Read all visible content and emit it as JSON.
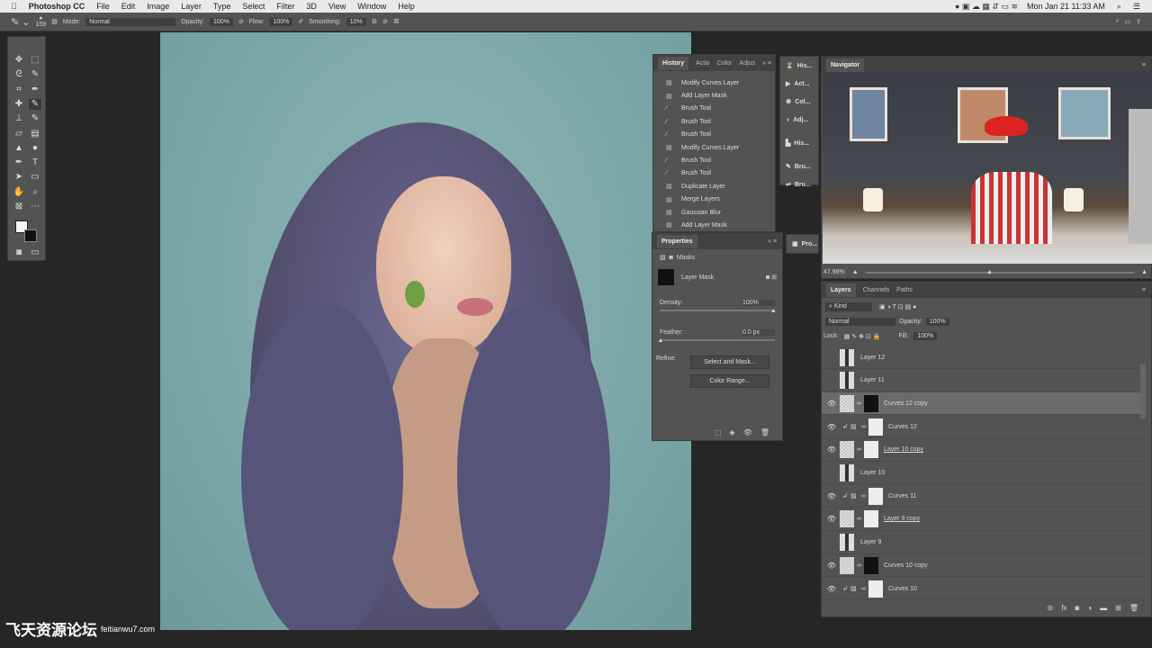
{
  "menubar": {
    "app": "Photoshop CC",
    "items": [
      "File",
      "Edit",
      "Image",
      "Layer",
      "Type",
      "Select",
      "Filter",
      "3D",
      "View",
      "Window",
      "Help"
    ],
    "clock": "Mon Jan 21  11:33 AM"
  },
  "options": {
    "brush_size": "159",
    "mode_label": "Mode:",
    "mode": "Normal",
    "opacity_label": "Opacity:",
    "opacity": "100%",
    "flow_label": "Flow:",
    "flow": "100%",
    "smoothing_label": "Smoothing:",
    "smoothing": "10%"
  },
  "history": {
    "tabs": [
      "History",
      "Actio",
      "Color",
      "Adjus"
    ],
    "items": [
      {
        "label": "Modify Curves Layer",
        "icon": "doc"
      },
      {
        "label": "Add Layer Mask",
        "icon": "doc"
      },
      {
        "label": "Brush Tool",
        "icon": "brush"
      },
      {
        "label": "Brush Tool",
        "icon": "brush"
      },
      {
        "label": "Brush Tool",
        "icon": "brush"
      },
      {
        "label": "Modify Curves Layer",
        "icon": "doc"
      },
      {
        "label": "Brush Tool",
        "icon": "brush"
      },
      {
        "label": "Brush Tool",
        "icon": "brush"
      },
      {
        "label": "Duplicate Layer",
        "icon": "doc"
      },
      {
        "label": "Merge Layers",
        "icon": "doc"
      },
      {
        "label": "Gaussian Blur",
        "icon": "doc"
      },
      {
        "label": "Add Layer Mask",
        "icon": "doc"
      }
    ]
  },
  "side_icons": [
    "His...",
    "Act...",
    "Col...",
    "Adj...",
    "His...",
    "Bru...",
    "Bru...",
    "Pro..."
  ],
  "properties": {
    "title": "Properties",
    "section": "Masks",
    "mask_label": "Layer Mask",
    "density_label": "Density:",
    "density": "100%",
    "density_fraction": 1.0,
    "feather_label": "Feather:",
    "feather": "0.0 px",
    "feather_fraction": 0.0,
    "refine_label": "Refine:",
    "select_mask": "Select and Mask...",
    "color_range": "Color Range..."
  },
  "navigator": {
    "title": "Navigator",
    "zoom": "47.98%"
  },
  "layers": {
    "tabs": [
      "Layers",
      "Channels",
      "Paths"
    ],
    "filter": "Kind",
    "blend": "Normal",
    "opacity_label": "Opacity:",
    "opacity": "100%",
    "lock_label": "Lock:",
    "fill_label": "Fill:",
    "fill": "100%",
    "rows": [
      {
        "name": "Layer 12",
        "visible": false,
        "type": "pixel",
        "mask": "",
        "selected": false
      },
      {
        "name": "Layer 11",
        "visible": false,
        "type": "pixel",
        "mask": "",
        "selected": false
      },
      {
        "name": "Curves 12 copy",
        "visible": true,
        "type": "trans",
        "mask": "black",
        "selected": true
      },
      {
        "name": "Curves 12",
        "visible": true,
        "type": "curves",
        "mask": "white",
        "selected": false
      },
      {
        "name": "Layer 10 copy",
        "visible": true,
        "type": "trans",
        "mask": "white",
        "selected": false
      },
      {
        "name": "Layer 10",
        "visible": false,
        "type": "pixel",
        "mask": "",
        "selected": false
      },
      {
        "name": "Curves 11",
        "visible": true,
        "type": "curves",
        "mask": "white",
        "selected": false
      },
      {
        "name": "Layer 9 copy",
        "visible": true,
        "type": "trans",
        "mask": "white",
        "selected": false
      },
      {
        "name": "Layer 9",
        "visible": false,
        "type": "pixel",
        "mask": "",
        "selected": false
      },
      {
        "name": "Curves 10 copy",
        "visible": true,
        "type": "trans",
        "mask": "black",
        "selected": false
      },
      {
        "name": "Curves 10",
        "visible": true,
        "type": "curves",
        "mask": "white",
        "selected": false
      }
    ]
  },
  "watermark": {
    "cn": "飞天资源论坛",
    "url": "feitianwu7.com"
  }
}
